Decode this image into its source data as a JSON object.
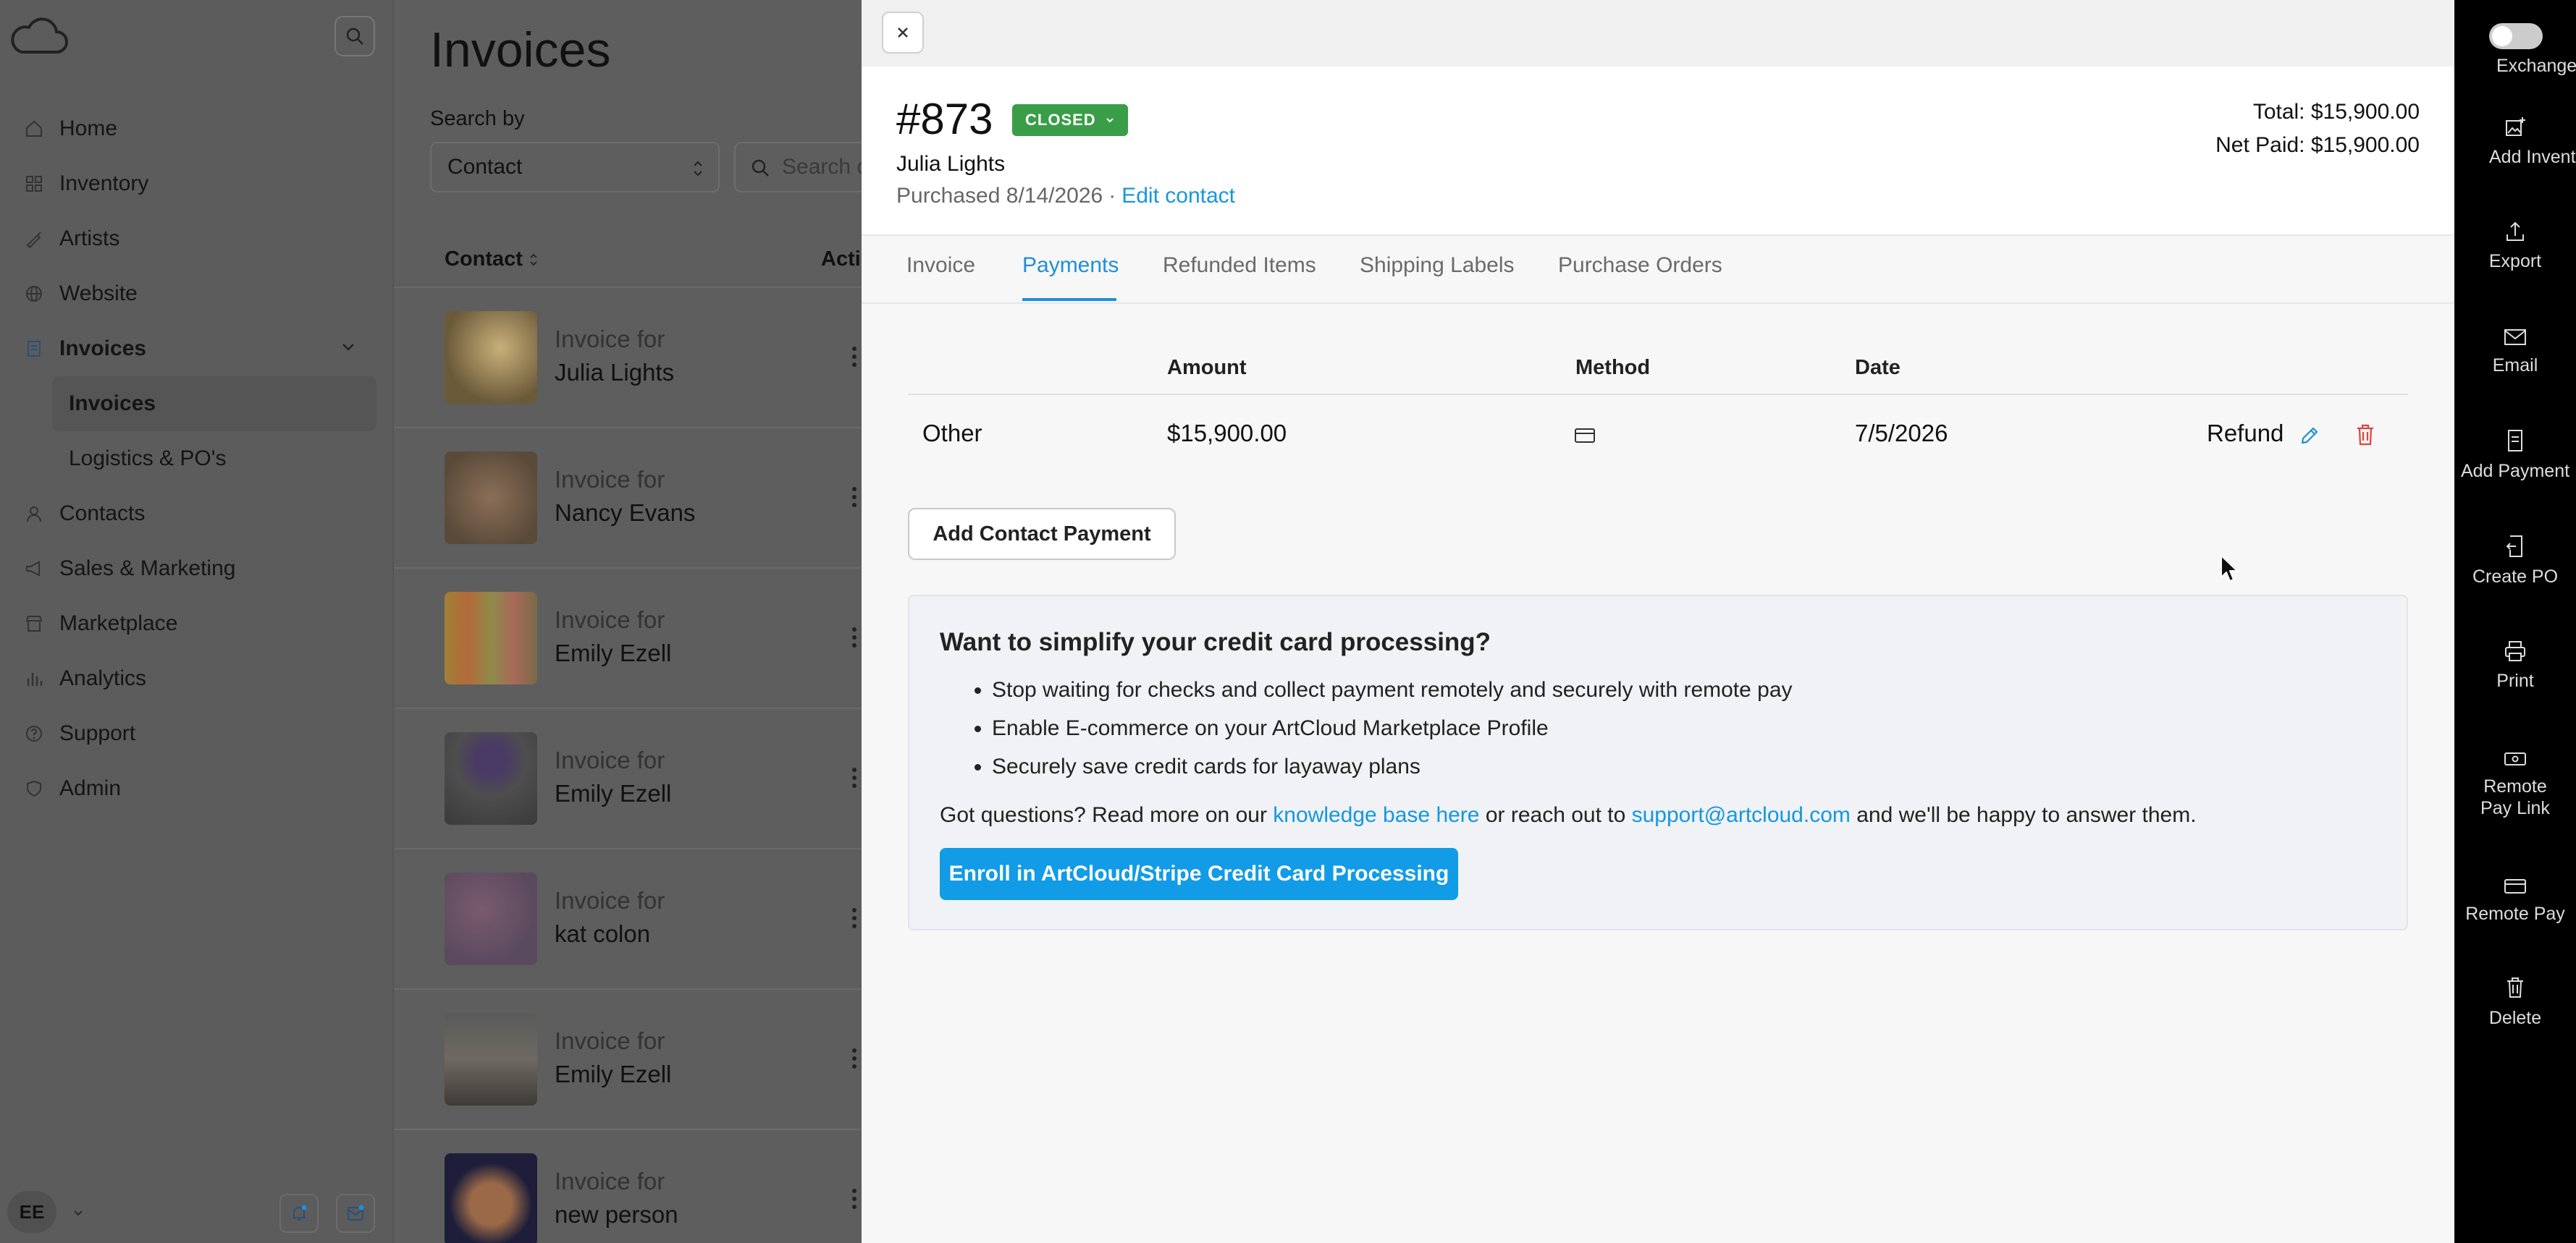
{
  "sidebar": {
    "nav": [
      {
        "label": "Home",
        "icon": "home-icon"
      },
      {
        "label": "Inventory",
        "icon": "inventory-icon"
      },
      {
        "label": "Artists",
        "icon": "brush-icon"
      },
      {
        "label": "Website",
        "icon": "globe-icon"
      },
      {
        "label": "Invoices",
        "icon": "invoice-icon",
        "expanded": true
      },
      {
        "label": "Contacts",
        "icon": "user-icon"
      },
      {
        "label": "Sales & Marketing",
        "icon": "megaphone-icon"
      },
      {
        "label": "Marketplace",
        "icon": "store-icon"
      },
      {
        "label": "Analytics",
        "icon": "bar-chart-icon"
      },
      {
        "label": "Support",
        "icon": "help-icon"
      },
      {
        "label": "Admin",
        "icon": "shield-icon"
      }
    ],
    "sub_items": [
      {
        "label": "Invoices",
        "active": true
      },
      {
        "label": "Logistics & PO's",
        "active": false
      }
    ],
    "user_initials": "EE"
  },
  "list": {
    "title": "Invoices",
    "search_by_label": "Search by",
    "search_by_value": "Contact",
    "search_placeholder": "Search c",
    "col_contact": "Contact",
    "col_actions": "Actio",
    "rows": [
      {
        "line1": "Invoice for",
        "line2": "Julia Lights"
      },
      {
        "line1": "Invoice for",
        "line2": "Nancy Evans"
      },
      {
        "line1": "Invoice for",
        "line2": "Emily Ezell"
      },
      {
        "line1": "Invoice for",
        "line2": "Emily Ezell"
      },
      {
        "line1": "Invoice for",
        "line2": "kat colon"
      },
      {
        "line1": "Invoice for",
        "line2": "Emily Ezell"
      },
      {
        "line1": "Invoice for",
        "line2": "new person"
      }
    ]
  },
  "invoice": {
    "number": "#873",
    "status": "CLOSED",
    "status_color": "#3a9d47",
    "contact_name": "Julia Lights",
    "purchased": "Purchased 8/14/2026",
    "separator": "·",
    "edit_contact": "Edit contact",
    "total": "Total: $15,900.00",
    "net_paid": "Net Paid: $15,900.00"
  },
  "tabs": [
    {
      "label": "Invoice",
      "active": false
    },
    {
      "label": "Payments",
      "active": true
    },
    {
      "label": "Refunded Items",
      "active": false
    },
    {
      "label": "Shipping Labels",
      "active": false
    },
    {
      "label": "Purchase Orders",
      "active": false
    }
  ],
  "payments": {
    "headers": {
      "amount": "Amount",
      "method": "Method",
      "date": "Date"
    },
    "rows": [
      {
        "type": "Other",
        "amount": "$15,900.00",
        "method_icon": "credit-card-icon",
        "date": "7/5/2026",
        "refund_label": "Refund"
      }
    ],
    "add_button": "Add Contact Payment"
  },
  "promo": {
    "title": "Want to simplify your credit card processing?",
    "bullets": [
      "Stop waiting for checks and collect payment remotely and securely with remote pay",
      "Enable E-commerce on your ArtCloud Marketplace Profile",
      "Securely save credit cards for layaway plans"
    ],
    "text_before": "Got questions? Read more on our ",
    "kb_link": "knowledge base here",
    "text_middle": " or reach out to ",
    "email_link": "support@artcloud.com",
    "text_after": " and we'll be happy to answer them.",
    "enroll_button": "Enroll in ArtCloud/Stripe Credit Card Processing"
  },
  "rail": {
    "items": [
      {
        "label": "Exchange Rate",
        "icon": "toggle-icon"
      },
      {
        "label": "Add Inventory",
        "icon": "add-image-icon"
      },
      {
        "label": "Export",
        "icon": "upload-icon"
      },
      {
        "label": "Email",
        "icon": "mail-icon"
      },
      {
        "label": "Add Payment",
        "icon": "receipt-icon"
      },
      {
        "label": "Create PO",
        "icon": "document-arrow-icon"
      },
      {
        "label": "Print",
        "icon": "printer-icon"
      },
      {
        "label": "Remote Pay Link",
        "icon": "cash-icon"
      },
      {
        "label": "Remote Pay",
        "icon": "credit-card-icon"
      },
      {
        "label": "Delete",
        "icon": "trash-icon"
      }
    ]
  },
  "colors": {
    "accent": "#1f8fd6",
    "link": "#1497e0",
    "button": "#129be6",
    "danger": "#e0443a"
  }
}
